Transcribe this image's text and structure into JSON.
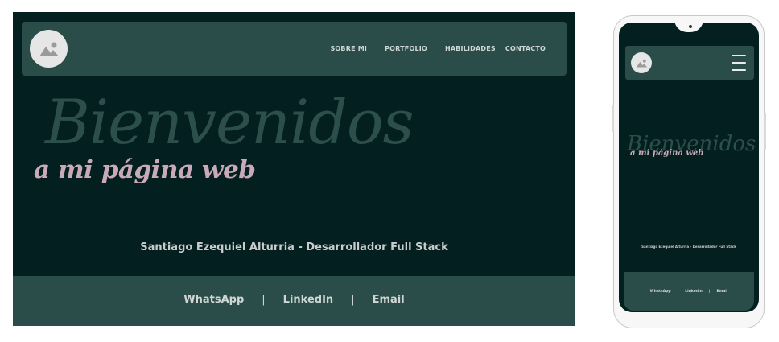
{
  "desktop": {
    "nav": [
      "SOBRE MI",
      "PORTFOLIO",
      "HABILIDADES",
      "CONTACTO"
    ],
    "hero": {
      "title": "Bienvenidos",
      "subtitle": "a mi página web"
    },
    "tagline": "Santiago Ezequiel Alturria - Desarrollador Full Stack",
    "footer": {
      "whatsapp": "WhatsApp",
      "linkedin": "LinkedIn",
      "email": "Email",
      "separator": "|"
    }
  },
  "mobile": {
    "hero": {
      "title": "Bienvenidos",
      "subtitle": "a mi página web"
    },
    "tagline": "Santiago Ezequiel Alturria - Desarrollador Full Stack",
    "footer": {
      "whatsapp": "WhatsApp",
      "linkedin": "Linkedin",
      "email": "Email",
      "separator": "|"
    }
  },
  "icons": {
    "avatar": "image-placeholder-icon",
    "menu": "hamburger-menu-icon"
  },
  "colors": {
    "background": "#031f1f",
    "panel": "#2a4d49",
    "hero_title": "#2c4f4b",
    "hero_subtitle": "#c9aab8",
    "text": "#cbcbcb"
  }
}
